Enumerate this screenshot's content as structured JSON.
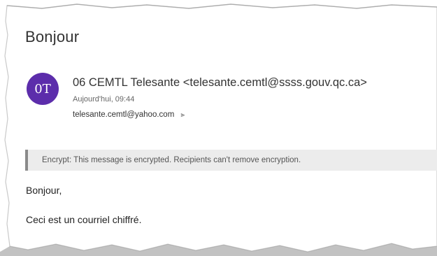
{
  "email": {
    "subject": "Bonjour",
    "avatar_initials": "0T",
    "avatar_color": "#5c2dab",
    "sender": "06 CEMTL Telesante <telesante.cemtl@ssss.gouv.qc.ca>",
    "date": "Aujourd'hui, 09:44",
    "recipient": "telesante.cemtl@yahoo.com",
    "expand_icon": "chevron-double-down-icon",
    "encryption_notice": "Encrypt: This message is encrypted. Recipients can't remove encryption.",
    "body": {
      "greeting": "Bonjour,",
      "text": "Ceci est un courriel chiffré."
    }
  }
}
